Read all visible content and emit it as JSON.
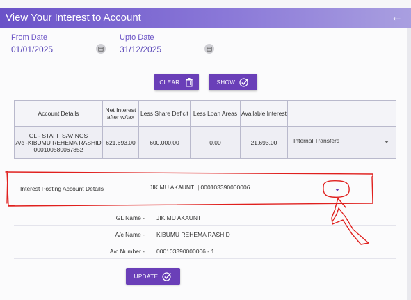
{
  "header": {
    "title": "View Your Interest to Account",
    "back_icon": "←"
  },
  "filters": {
    "from_date_label": "From Date",
    "from_date_value": "01/01/2025",
    "upto_date_label": "Upto Date",
    "upto_date_value": "31/12/2025"
  },
  "actions": {
    "clear_label": "CLEAR",
    "show_label": "SHOW",
    "update_label": "UPDATE"
  },
  "table": {
    "headers": [
      "Account Details",
      "Net Interest after w/tax",
      "Less Share Deficit",
      "Less Loan Areas",
      "Available Interest",
      ""
    ],
    "header_lines": [
      [
        "Account Details"
      ],
      [
        "Net Interest",
        "after w/tax"
      ],
      [
        "Less Share Deficit"
      ],
      [
        "Less Loan Areas"
      ],
      [
        "Available Interest"
      ],
      [
        ""
      ]
    ],
    "row": {
      "account_lines": [
        "GL - STAFF SAVINGS",
        "A/c -KIBUMU REHEMA RASHID",
        "000100580067852"
      ],
      "net_interest": "621,693.00",
      "share_deficit": "600,000.00",
      "loan_areas": "0.00",
      "available_interest": "21,693.00",
      "transfer_type": "Internal Transfers"
    }
  },
  "posting": {
    "label": "Interest Posting Account Details",
    "selected": "JIKIMU AKAUNTI | 000103390000006"
  },
  "details": [
    {
      "key": "GL Name -",
      "value": "JIKIMU AKAUNTI"
    },
    {
      "key": "A/c Name -",
      "value": "KIBUMU REHEMA RASHID"
    },
    {
      "key": "A/c Number -",
      "value": "000103390000006 - 1"
    }
  ],
  "colors": {
    "primary": "#6a3fb8",
    "header_start": "#6a52c8",
    "annotation": "#e0201e"
  }
}
